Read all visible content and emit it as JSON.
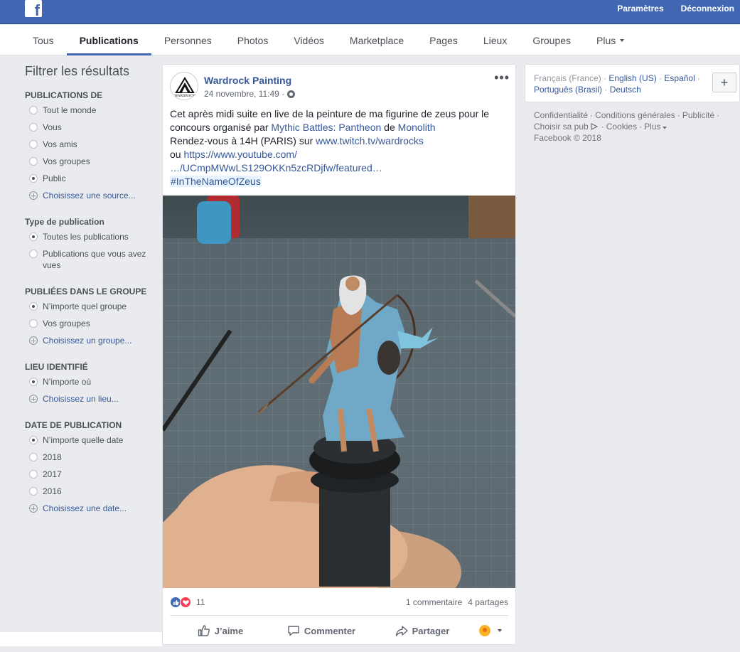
{
  "topbar": {
    "logo_letter": "f",
    "links": [
      "Paramètres",
      "Déconnexion"
    ]
  },
  "tabs": [
    {
      "label": "Tous",
      "active": false
    },
    {
      "label": "Publications",
      "active": true
    },
    {
      "label": "Personnes",
      "active": false
    },
    {
      "label": "Photos",
      "active": false
    },
    {
      "label": "Vidéos",
      "active": false
    },
    {
      "label": "Marketplace",
      "active": false
    },
    {
      "label": "Pages",
      "active": false
    },
    {
      "label": "Lieux",
      "active": false
    },
    {
      "label": "Groupes",
      "active": false
    },
    {
      "label": "Plus",
      "active": false
    }
  ],
  "filters": {
    "title": "Filtrer les résultats",
    "sections": [
      {
        "title": "PUBLICATIONS DE",
        "options": [
          {
            "type": "radio",
            "label": "Tout le monde",
            "checked": false
          },
          {
            "type": "radio",
            "label": "Vous",
            "checked": false
          },
          {
            "type": "radio",
            "label": "Vos amis",
            "checked": false
          },
          {
            "type": "radio",
            "label": "Vos groupes",
            "checked": false
          },
          {
            "type": "radio",
            "label": "Public",
            "checked": true
          },
          {
            "type": "add",
            "label": "Choisissez une source..."
          }
        ]
      },
      {
        "title": "Type de publication",
        "options": [
          {
            "type": "radio",
            "label": "Toutes les publications",
            "checked": true
          },
          {
            "type": "radio",
            "label": "Publications que vous avez vues",
            "checked": false
          }
        ]
      },
      {
        "title": "PUBLIÉES DANS LE GROUPE",
        "options": [
          {
            "type": "radio",
            "label": "N’importe quel groupe",
            "checked": true
          },
          {
            "type": "radio",
            "label": "Vos groupes",
            "checked": false
          },
          {
            "type": "add",
            "label": "Choisissez un groupe..."
          }
        ]
      },
      {
        "title": "LIEU IDENTIFIÉ",
        "options": [
          {
            "type": "radio",
            "label": "N’importe où",
            "checked": true
          },
          {
            "type": "add",
            "label": "Choisissez un lieu..."
          }
        ]
      },
      {
        "title": "DATE DE PUBLICATION",
        "options": [
          {
            "type": "radio",
            "label": "N’importe quelle date",
            "checked": true
          },
          {
            "type": "radio",
            "label": "2018",
            "checked": false
          },
          {
            "type": "radio",
            "label": "2017",
            "checked": false
          },
          {
            "type": "radio",
            "label": "2016",
            "checked": false
          },
          {
            "type": "add",
            "label": "Choisissez une date..."
          }
        ]
      }
    ]
  },
  "post": {
    "author": "Wardrock Painting",
    "avatar_text": "WARDROCK",
    "date": "24 novembre, 11:49 ·",
    "more": "•••",
    "text": {
      "line1": "Cet après midi suite en live de la peinture de ma figurine de zeus pour le",
      "line2_prefix": "concours organisé par ",
      "link1": "Mythic Battles: Pantheon",
      "line2_mid": " de ",
      "link2": "Monolith",
      "line3_prefix": "Rendez-vous à 14H (PARIS) sur ",
      "link3": "www.twitch.tv/wardrocks",
      "line4_prefix": "ou ",
      "link4": "https://www.youtube.com/",
      "link5": "…/UCmpMWwLS129OKKn5zcRDjfw/featured…",
      "hashtag": "#InTheNameOfZeus"
    },
    "reactions_count": "11",
    "comments": "1 commentaire",
    "shares": "4 partages",
    "actions": {
      "like": "J’aime",
      "comment": "Commenter",
      "share": "Partager"
    }
  },
  "right": {
    "languages": {
      "current": "Français (France)",
      "others": [
        "English (US)",
        "Español",
        "Português (Brasil)",
        "Deutsch"
      ],
      "add": "+"
    },
    "footer": {
      "links": [
        "Confidentialité",
        "Conditions générales",
        "Publicité",
        "Choisir sa pub",
        "Cookies",
        "Plus"
      ],
      "copyright": "Facebook © 2018"
    }
  }
}
